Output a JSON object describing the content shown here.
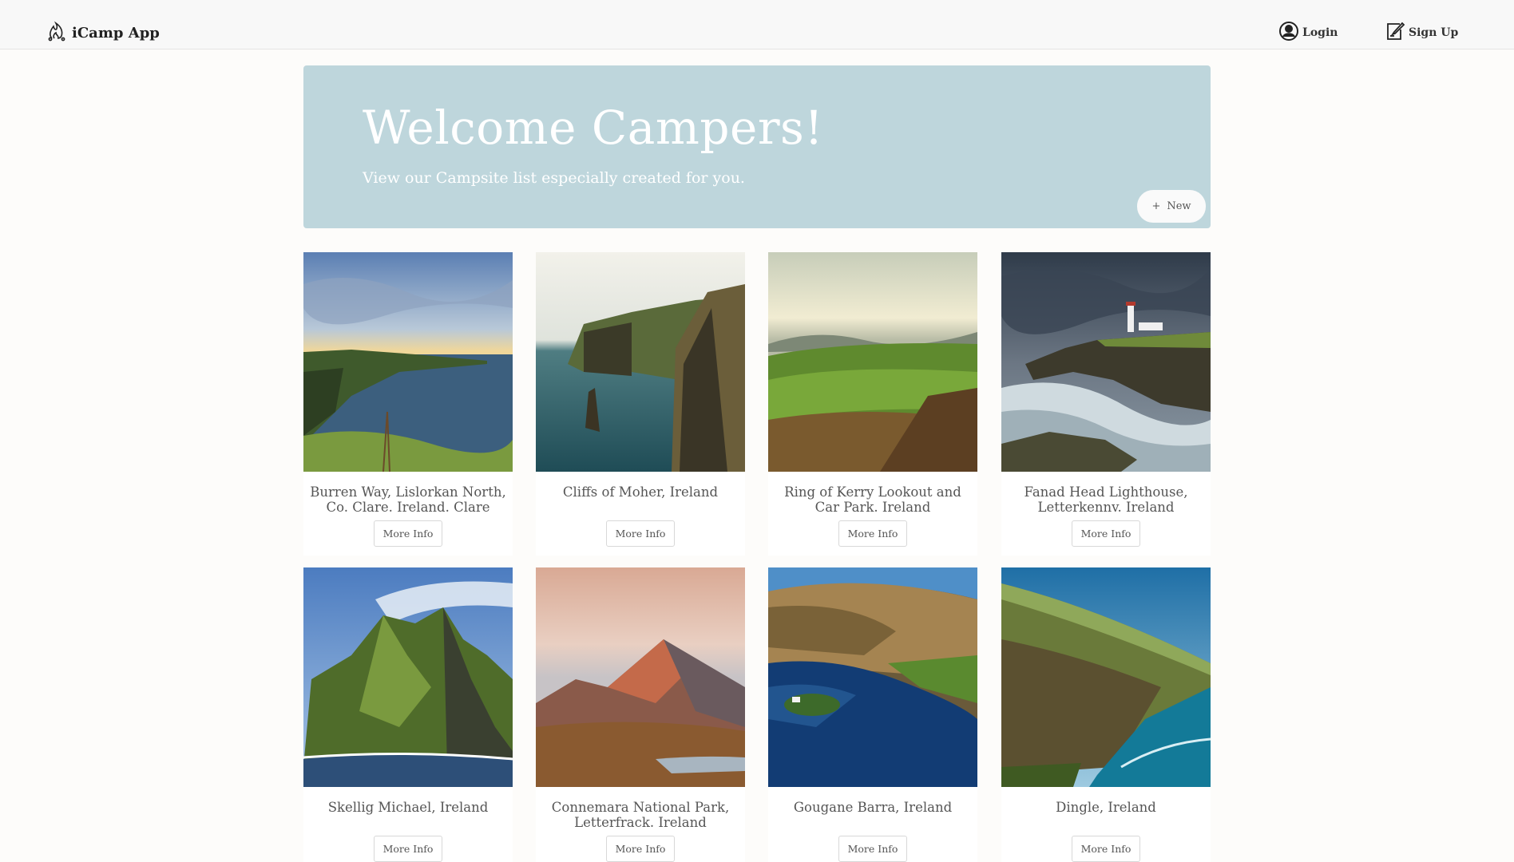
{
  "navbar": {
    "brand": "iCamp App",
    "brand_icon": "campfire-icon",
    "login_label": "Login",
    "login_icon": "user-circle-icon",
    "signup_label": "Sign Up",
    "signup_icon": "pencil-square-icon"
  },
  "hero": {
    "title": "Welcome Campers!",
    "subtitle": "View our Campsite list especially created for you.",
    "new_button_icon": "+",
    "new_button_label": "New",
    "background_color": "#bed6dc"
  },
  "campgrounds": [
    {
      "title": "Burren Way, Lislorkan North, Co. Clare. Ireland. Clare",
      "button": "More Info",
      "scene": "cliffs-sunset"
    },
    {
      "title": "Cliffs of Moher, Ireland",
      "button": "More Info",
      "scene": "sea-cliffs"
    },
    {
      "title": "Ring of Kerry Lookout and Car Park. Ireland",
      "button": "More Info",
      "scene": "green-valley"
    },
    {
      "title": "Fanad Head Lighthouse, Letterkennv. Ireland",
      "button": "More Info",
      "scene": "lighthouse-storm"
    },
    {
      "title": "Skellig Michael, Ireland",
      "button": "More Info",
      "scene": "island-peak"
    },
    {
      "title": "Connemara National Park, Letterfrack. Ireland",
      "button": "More Info",
      "scene": "mountain-dusk"
    },
    {
      "title": "Gougane Barra, Ireland",
      "button": "More Info",
      "scene": "lake-valley"
    },
    {
      "title": "Dingle, Ireland",
      "button": "More Info",
      "scene": "coastal-slope"
    }
  ]
}
